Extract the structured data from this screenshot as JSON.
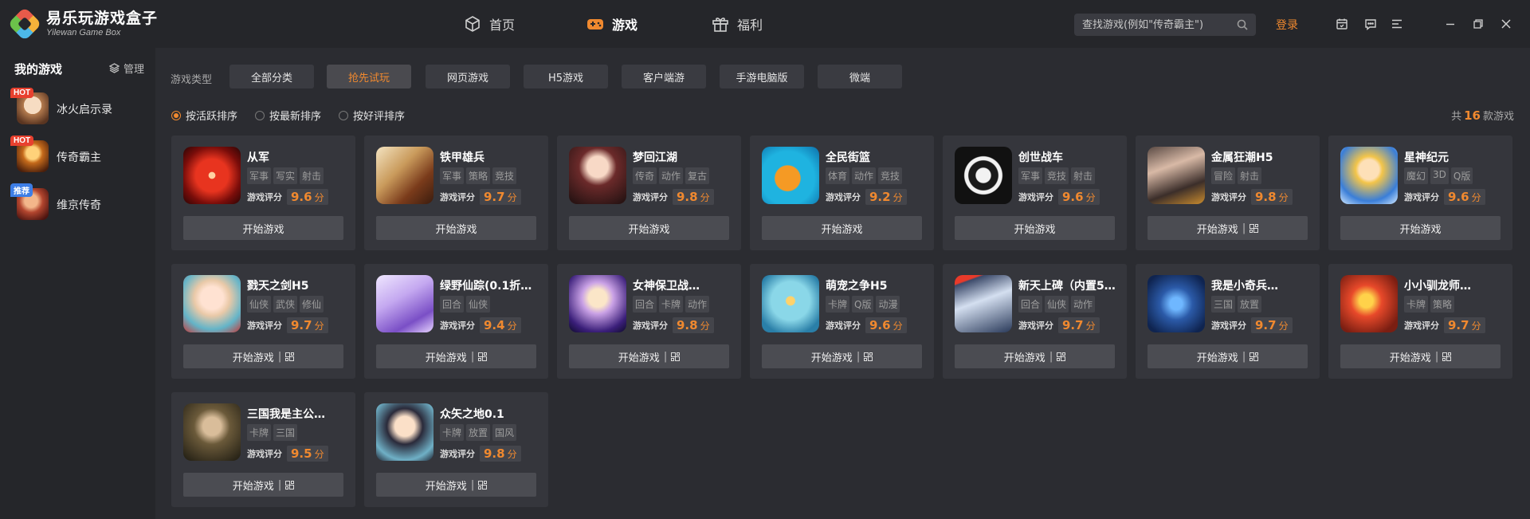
{
  "app": {
    "title_cn": "易乐玩游戏盒子",
    "title_en": "Yilewan Game Box"
  },
  "nav": [
    {
      "label": "首页",
      "icon": "cube-icon",
      "active": false
    },
    {
      "label": "游戏",
      "icon": "gamepad-icon",
      "active": true
    },
    {
      "label": "福利",
      "icon": "gift-icon",
      "active": false
    }
  ],
  "search": {
    "placeholder": "查找游戏(例如\"传奇霸主\")"
  },
  "header": {
    "login": "登录"
  },
  "sidebar": {
    "title": "我的游戏",
    "manage": "管理",
    "items": [
      {
        "name": "冰火启示录",
        "badge": "HOT"
      },
      {
        "name": "传奇霸主",
        "badge": "HOT"
      },
      {
        "name": "维京传奇",
        "badge": "推荐"
      }
    ]
  },
  "filters": {
    "type_label": "游戏类型",
    "types": [
      "全部分类",
      "抢先试玩",
      "网页游戏",
      "H5游戏",
      "客户端游",
      "手游电脑版",
      "微端"
    ],
    "active_type": "抢先试玩",
    "sorts": [
      "按活跃排序",
      "按最新排序",
      "按好评排序"
    ],
    "active_sort": "按活跃排序",
    "total_prefix": "共",
    "total_count": "16",
    "total_suffix": "款游戏"
  },
  "labels": {
    "rating": "游戏评分",
    "unit": "分",
    "play": "开始游戏",
    "sep": "|"
  },
  "games": [
    {
      "name": "从军",
      "tags": [
        "军事",
        "写实",
        "射击"
      ],
      "score": "9.6",
      "qr": false
    },
    {
      "name": "铁甲雄兵",
      "tags": [
        "军事",
        "策略",
        "竞技"
      ],
      "score": "9.7",
      "qr": false
    },
    {
      "name": "梦回江湖",
      "tags": [
        "传奇",
        "动作",
        "复古"
      ],
      "score": "9.8",
      "qr": false
    },
    {
      "name": "全民街篮",
      "tags": [
        "体育",
        "动作",
        "竞技"
      ],
      "score": "9.2",
      "qr": false
    },
    {
      "name": "创世战车",
      "tags": [
        "军事",
        "竞技",
        "射击"
      ],
      "score": "9.6",
      "qr": false
    },
    {
      "name": "金属狂潮H5",
      "tags": [
        "冒险",
        "射击"
      ],
      "score": "9.8",
      "qr": true
    },
    {
      "name": "星神纪元",
      "tags": [
        "魔幻",
        "3D",
        "Q版"
      ],
      "score": "9.6",
      "qr": false
    },
    {
      "name": "戮天之剑H5",
      "tags": [
        "仙侠",
        "武侠",
        "修仙"
      ],
      "score": "9.7",
      "qr": true
    },
    {
      "name": "绿野仙踪(0.1折仙…",
      "tags": [
        "回合",
        "仙侠"
      ],
      "score": "9.4",
      "qr": true
    },
    {
      "name": "女神保卫战…",
      "tags": [
        "回合",
        "卡牌",
        "动作"
      ],
      "score": "9.8",
      "qr": true
    },
    {
      "name": "萌宠之争H5",
      "tags": [
        "卡牌",
        "Q版",
        "动漫"
      ],
      "score": "9.6",
      "qr": true
    },
    {
      "name": "新天上碑（内置5折…",
      "tags": [
        "回合",
        "仙侠",
        "动作"
      ],
      "score": "9.7",
      "qr": true
    },
    {
      "name": "我是小奇兵…",
      "tags": [
        "三国",
        "放置"
      ],
      "score": "9.7",
      "qr": true
    },
    {
      "name": "小小驯龙师…",
      "tags": [
        "卡牌",
        "策略"
      ],
      "score": "9.7",
      "qr": true
    },
    {
      "name": "三国我是主公…",
      "tags": [
        "卡牌",
        "三国"
      ],
      "score": "9.5",
      "qr": true
    },
    {
      "name": "众矢之地0.1",
      "tags": [
        "卡牌",
        "放置",
        "国风"
      ],
      "score": "9.8",
      "qr": true
    }
  ]
}
